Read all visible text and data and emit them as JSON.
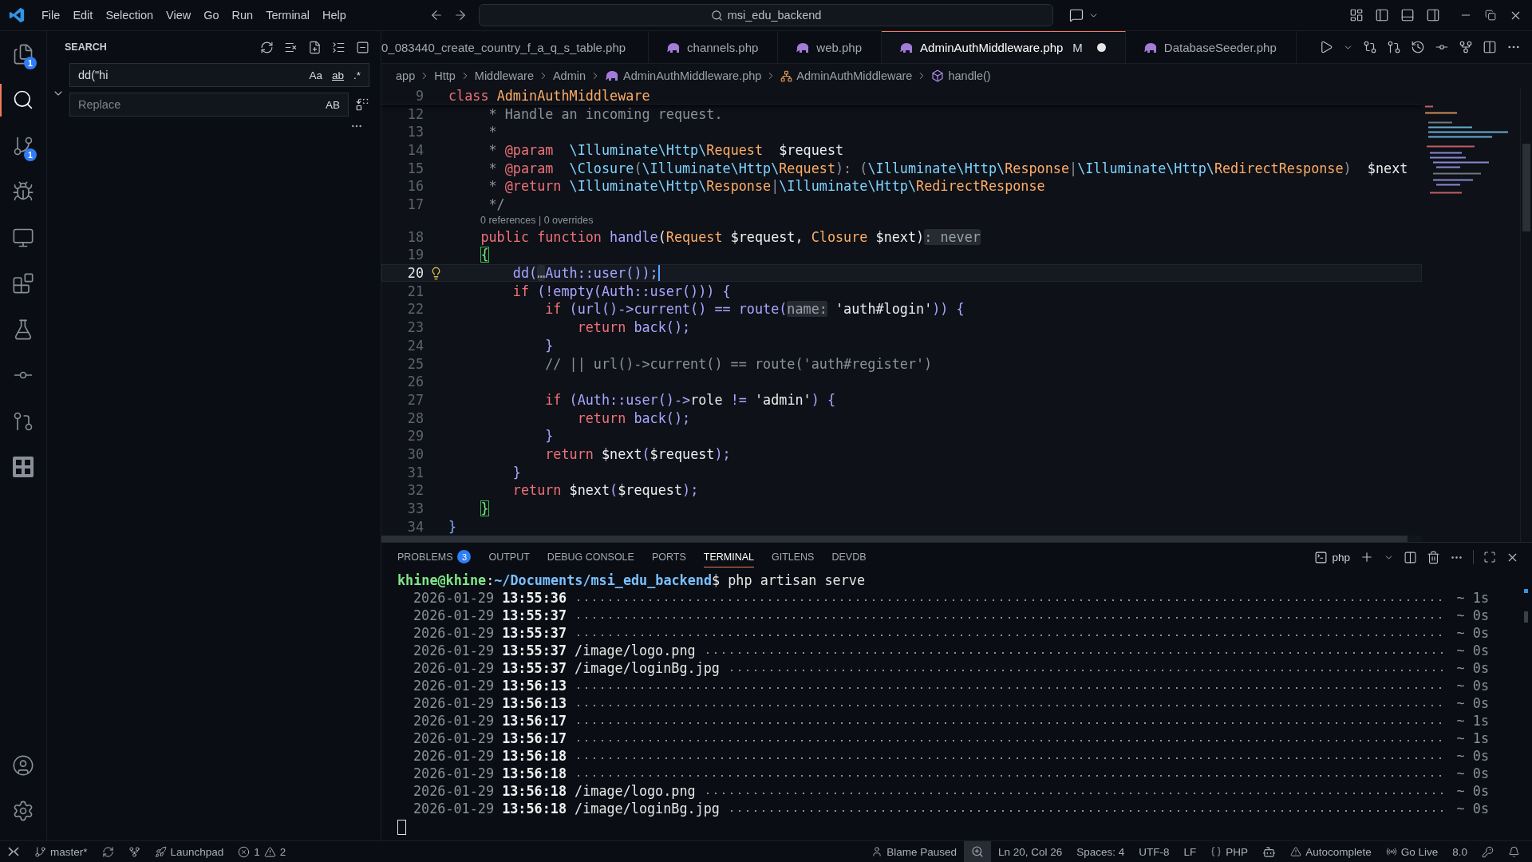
{
  "title_bar": {
    "menus": [
      "File",
      "Edit",
      "Selection",
      "View",
      "Go",
      "Run",
      "Terminal",
      "Help"
    ],
    "command_center": "msi_edu_backend"
  },
  "activity_bar": {
    "items": [
      {
        "kind": "explorer",
        "selected": false,
        "badge": "1"
      },
      {
        "kind": "search",
        "selected": true
      },
      {
        "kind": "source-control",
        "selected": false,
        "badge": "1"
      },
      {
        "kind": "run-debug",
        "selected": false
      },
      {
        "kind": "remote",
        "selected": false
      },
      {
        "kind": "extensions",
        "selected": false
      },
      {
        "kind": "testing",
        "selected": false
      },
      {
        "kind": "gitlens",
        "selected": false
      },
      {
        "kind": "gitlens-inspect",
        "selected": false
      },
      {
        "kind": "square-logo",
        "selected": false
      }
    ],
    "bottom": [
      {
        "kind": "accounts"
      },
      {
        "kind": "settings"
      }
    ]
  },
  "sidebar": {
    "title": "SEARCH",
    "expanded": true,
    "search": {
      "value": "dd(\"hi",
      "options": [
        {
          "label": "Aa",
          "on": false
        },
        {
          "label": "ab",
          "on": false
        },
        {
          "label": ".*",
          "on": false
        }
      ]
    },
    "replace": {
      "placeholder": "Replace",
      "options": [
        {
          "label": "AB",
          "on": false
        }
      ]
    }
  },
  "editor": {
    "tabs": [
      {
        "label": "0_083440_create_country_f_a_q_s_table.php",
        "selected": false,
        "icon": false
      },
      {
        "label": "channels.php",
        "selected": false,
        "icon": true
      },
      {
        "label": "web.php",
        "selected": false,
        "icon": true
      },
      {
        "label": "AdminAuthMiddleware.php",
        "selected": true,
        "icon": true,
        "status": "M",
        "dirty": true
      },
      {
        "label": "DatabaseSeeder.php",
        "selected": false,
        "icon": true
      }
    ],
    "breadcrumb": [
      {
        "label": "app",
        "kind": "folder"
      },
      {
        "label": "Http",
        "kind": "folder"
      },
      {
        "label": "Middleware",
        "kind": "folder"
      },
      {
        "label": "Admin",
        "kind": "folder"
      },
      {
        "label": "AdminAuthMiddleware.php",
        "kind": "file"
      },
      {
        "label": "AdminAuthMiddleware",
        "kind": "class"
      },
      {
        "label": "handle()",
        "kind": "method"
      }
    ],
    "sticky": {
      "number": "9",
      "tokens": [
        {
          "kind": "keyword",
          "text": "class "
        },
        {
          "kind": "class",
          "text": "AdminAuthMiddleware"
        }
      ]
    },
    "lines": [
      {
        "kind": "code",
        "number": "12",
        "current": false,
        "lightbulb": false,
        "tokens": [
          {
            "kind": "comment",
            "text": "     * Handle an incoming request."
          }
        ]
      },
      {
        "kind": "code",
        "number": "13",
        "current": false,
        "lightbulb": false,
        "tokens": [
          {
            "kind": "comment",
            "text": "     *"
          }
        ]
      },
      {
        "kind": "code",
        "number": "14",
        "current": false,
        "lightbulb": false,
        "tokens": [
          {
            "kind": "comment",
            "text": "     * "
          },
          {
            "kind": "doctag",
            "text": "@param  "
          },
          {
            "kind": "namespace",
            "text": "\\Illuminate\\Http\\"
          },
          {
            "kind": "class",
            "text": "Request"
          },
          {
            "kind": "variable",
            "text": "  $request"
          }
        ]
      },
      {
        "kind": "code",
        "number": "15",
        "current": false,
        "lightbulb": false,
        "tokens": [
          {
            "kind": "comment",
            "text": "     * "
          },
          {
            "kind": "doctag",
            "text": "@param  "
          },
          {
            "kind": "namespace",
            "text": "\\Closure"
          },
          {
            "kind": "comment",
            "text": "("
          },
          {
            "kind": "namespace",
            "text": "\\Illuminate\\Http\\"
          },
          {
            "kind": "class",
            "text": "Request"
          },
          {
            "kind": "comment",
            "text": "): ("
          },
          {
            "kind": "namespace",
            "text": "\\Illuminate\\Http\\"
          },
          {
            "kind": "class",
            "text": "Response"
          },
          {
            "kind": "comment",
            "text": "|"
          },
          {
            "kind": "namespace",
            "text": "\\Illuminate\\Http\\"
          },
          {
            "kind": "class",
            "text": "RedirectResponse"
          },
          {
            "kind": "comment",
            "text": ")"
          },
          {
            "kind": "variable",
            "text": "  $next"
          }
        ]
      },
      {
        "kind": "code",
        "number": "16",
        "current": false,
        "lightbulb": false,
        "tokens": [
          {
            "kind": "comment",
            "text": "     * "
          },
          {
            "kind": "doctag",
            "text": "@return "
          },
          {
            "kind": "namespace",
            "text": "\\Illuminate\\Http\\"
          },
          {
            "kind": "class",
            "text": "Response"
          },
          {
            "kind": "comment",
            "text": "|"
          },
          {
            "kind": "namespace",
            "text": "\\Illuminate\\Http\\"
          },
          {
            "kind": "class",
            "text": "RedirectResponse"
          }
        ]
      },
      {
        "kind": "code",
        "number": "17",
        "current": false,
        "lightbulb": false,
        "tokens": [
          {
            "kind": "comment",
            "text": "     */"
          }
        ]
      },
      {
        "kind": "codelens",
        "text": "0 references | 0 overrides"
      },
      {
        "kind": "code",
        "number": "18",
        "current": false,
        "lightbulb": false,
        "tokens": [
          {
            "kind": "keyword",
            "text": "    public function "
          },
          {
            "kind": "function",
            "text": "handle"
          },
          {
            "kind": "plain",
            "text": "("
          },
          {
            "kind": "class",
            "text": "Request"
          },
          {
            "kind": "variable",
            "text": " $request"
          },
          {
            "kind": "plain",
            "text": ", "
          },
          {
            "kind": "class",
            "text": "Closure"
          },
          {
            "kind": "variable",
            "text": " $next"
          },
          {
            "kind": "plain",
            "text": ")"
          },
          {
            "kind": "hint",
            "text": ": never"
          }
        ]
      },
      {
        "kind": "code",
        "number": "19",
        "current": false,
        "lightbulb": false,
        "tokens": [
          {
            "kind": "bracket-match",
            "text": "    {"
          }
        ]
      },
      {
        "kind": "code",
        "number": "20",
        "current": true,
        "lightbulb": true,
        "tokens": [
          {
            "kind": "function",
            "text": "        dd("
          },
          {
            "kind": "hint",
            "text": "…"
          },
          {
            "kind": "function",
            "text": "Auth::user());"
          }
        ]
      },
      {
        "kind": "code",
        "number": "21",
        "current": false,
        "lightbulb": false,
        "tokens": [
          {
            "kind": "keyword",
            "text": "        if "
          },
          {
            "kind": "function",
            "text": "(!empty(Auth::user())) {"
          }
        ]
      },
      {
        "kind": "code",
        "number": "22",
        "current": false,
        "lightbulb": false,
        "tokens": [
          {
            "kind": "keyword",
            "text": "            if "
          },
          {
            "kind": "function",
            "text": "(url()->current() == route("
          },
          {
            "kind": "hint",
            "text": "name:"
          },
          {
            "kind": "string",
            "text": " 'auth#login'"
          },
          {
            "kind": "function",
            "text": ")) {"
          }
        ]
      },
      {
        "kind": "code",
        "number": "23",
        "current": false,
        "lightbulb": false,
        "tokens": [
          {
            "kind": "keyword",
            "text": "                return "
          },
          {
            "kind": "function",
            "text": "back();"
          }
        ]
      },
      {
        "kind": "code",
        "number": "24",
        "current": false,
        "lightbulb": false,
        "tokens": [
          {
            "kind": "function",
            "text": "            }"
          }
        ]
      },
      {
        "kind": "code",
        "number": "25",
        "current": false,
        "lightbulb": false,
        "tokens": [
          {
            "kind": "comment",
            "text": "            // || url()->current() == route('auth#register')"
          }
        ]
      },
      {
        "kind": "code",
        "number": "26",
        "current": false,
        "lightbulb": false
      },
      {
        "kind": "code",
        "number": "27",
        "current": false,
        "lightbulb": false,
        "tokens": [
          {
            "kind": "keyword",
            "text": "            if "
          },
          {
            "kind": "function",
            "text": "(Auth::user()->"
          },
          {
            "kind": "plain",
            "text": "role"
          },
          {
            "kind": "function",
            "text": " != "
          },
          {
            "kind": "string",
            "text": "'admin'"
          },
          {
            "kind": "function",
            "text": ") {"
          }
        ]
      },
      {
        "kind": "code",
        "number": "28",
        "current": false,
        "lightbulb": false,
        "tokens": [
          {
            "kind": "keyword",
            "text": "                return "
          },
          {
            "kind": "function",
            "text": "back();"
          }
        ]
      },
      {
        "kind": "code",
        "number": "29",
        "current": false,
        "lightbulb": false,
        "tokens": [
          {
            "kind": "function",
            "text": "            }"
          }
        ]
      },
      {
        "kind": "code",
        "number": "30",
        "current": false,
        "lightbulb": false,
        "tokens": [
          {
            "kind": "keyword",
            "text": "            return "
          },
          {
            "kind": "variable",
            "text": "$next"
          },
          {
            "kind": "function",
            "text": "("
          },
          {
            "kind": "variable",
            "text": "$request"
          },
          {
            "kind": "function",
            "text": ");"
          }
        ]
      },
      {
        "kind": "code",
        "number": "31",
        "current": false,
        "lightbulb": false,
        "tokens": [
          {
            "kind": "function",
            "text": "        }"
          }
        ]
      },
      {
        "kind": "code",
        "number": "32",
        "current": false,
        "lightbulb": false,
        "tokens": [
          {
            "kind": "keyword",
            "text": "        return "
          },
          {
            "kind": "variable",
            "text": "$next"
          },
          {
            "kind": "function",
            "text": "("
          },
          {
            "kind": "variable",
            "text": "$request"
          },
          {
            "kind": "function",
            "text": ");"
          }
        ]
      },
      {
        "kind": "code",
        "number": "33",
        "current": false,
        "lightbulb": false,
        "tokens": [
          {
            "kind": "bracket-match",
            "text": "    }"
          }
        ]
      },
      {
        "kind": "code",
        "number": "34",
        "current": false,
        "lightbulb": false,
        "tokens": [
          {
            "kind": "bracket",
            "text": "}"
          }
        ]
      }
    ]
  },
  "panel": {
    "tabs": [
      {
        "label": "PROBLEMS",
        "selected": false,
        "badge": "3"
      },
      {
        "label": "OUTPUT",
        "selected": false
      },
      {
        "label": "DEBUG CONSOLE",
        "selected": false
      },
      {
        "label": "PORTS",
        "selected": false
      },
      {
        "label": "TERMINAL",
        "selected": true
      },
      {
        "label": "GITLENS",
        "selected": false
      },
      {
        "label": "DEVDB",
        "selected": false
      }
    ],
    "terminal_name": "php",
    "prompt": {
      "user": "khine@khine",
      "separator": ":",
      "path": "~/Documents/msi_edu_backend",
      "command": "$ php artisan serve"
    },
    "rows": [
      {
        "date": "2026-01-29",
        "time": "13:55:36",
        "duration": "~ 1s"
      },
      {
        "date": "2026-01-29",
        "time": "13:55:37",
        "duration": "~ 0s"
      },
      {
        "date": "2026-01-29",
        "time": "13:55:37",
        "duration": "~ 0s"
      },
      {
        "date": "2026-01-29",
        "time": "13:55:37",
        "path": "/image/logo.png",
        "duration": "~ 0s"
      },
      {
        "date": "2026-01-29",
        "time": "13:55:37",
        "path": "/image/loginBg.jpg",
        "duration": "~ 0s"
      },
      {
        "date": "2026-01-29",
        "time": "13:56:13",
        "duration": "~ 0s"
      },
      {
        "date": "2026-01-29",
        "time": "13:56:13",
        "duration": "~ 0s"
      },
      {
        "date": "2026-01-29",
        "time": "13:56:17",
        "duration": "~ 1s"
      },
      {
        "date": "2026-01-29",
        "time": "13:56:17",
        "duration": "~ 1s"
      },
      {
        "date": "2026-01-29",
        "time": "13:56:18",
        "duration": "~ 0s"
      },
      {
        "date": "2026-01-29",
        "time": "13:56:18",
        "duration": "~ 0s"
      },
      {
        "date": "2026-01-29",
        "time": "13:56:18",
        "path": "/image/logo.png",
        "duration": "~ 0s"
      },
      {
        "date": "2026-01-29",
        "time": "13:56:18",
        "path": "/image/loginBg.jpg",
        "duration": "~ 0s"
      }
    ]
  },
  "status_bar": {
    "branch": "master*",
    "launchpad": "Launchpad",
    "errors": "1",
    "warnings": "2",
    "items": [
      {
        "kind": "blame",
        "text": "Blame Paused"
      },
      {
        "kind": "zoom"
      },
      {
        "kind": "text",
        "text": "Ln 20, Col 26"
      },
      {
        "kind": "text",
        "text": "Spaces: 4"
      },
      {
        "kind": "text",
        "text": "UTF-8"
      },
      {
        "kind": "text",
        "text": "LF"
      },
      {
        "kind": "language",
        "text": "PHP"
      },
      {
        "kind": "copilot"
      },
      {
        "kind": "autocomplete",
        "text": "Autocomplete"
      },
      {
        "kind": "golive",
        "text": "Go Live"
      },
      {
        "kind": "text",
        "text": "8.0"
      },
      {
        "kind": "key"
      },
      {
        "kind": "bell"
      }
    ]
  }
}
